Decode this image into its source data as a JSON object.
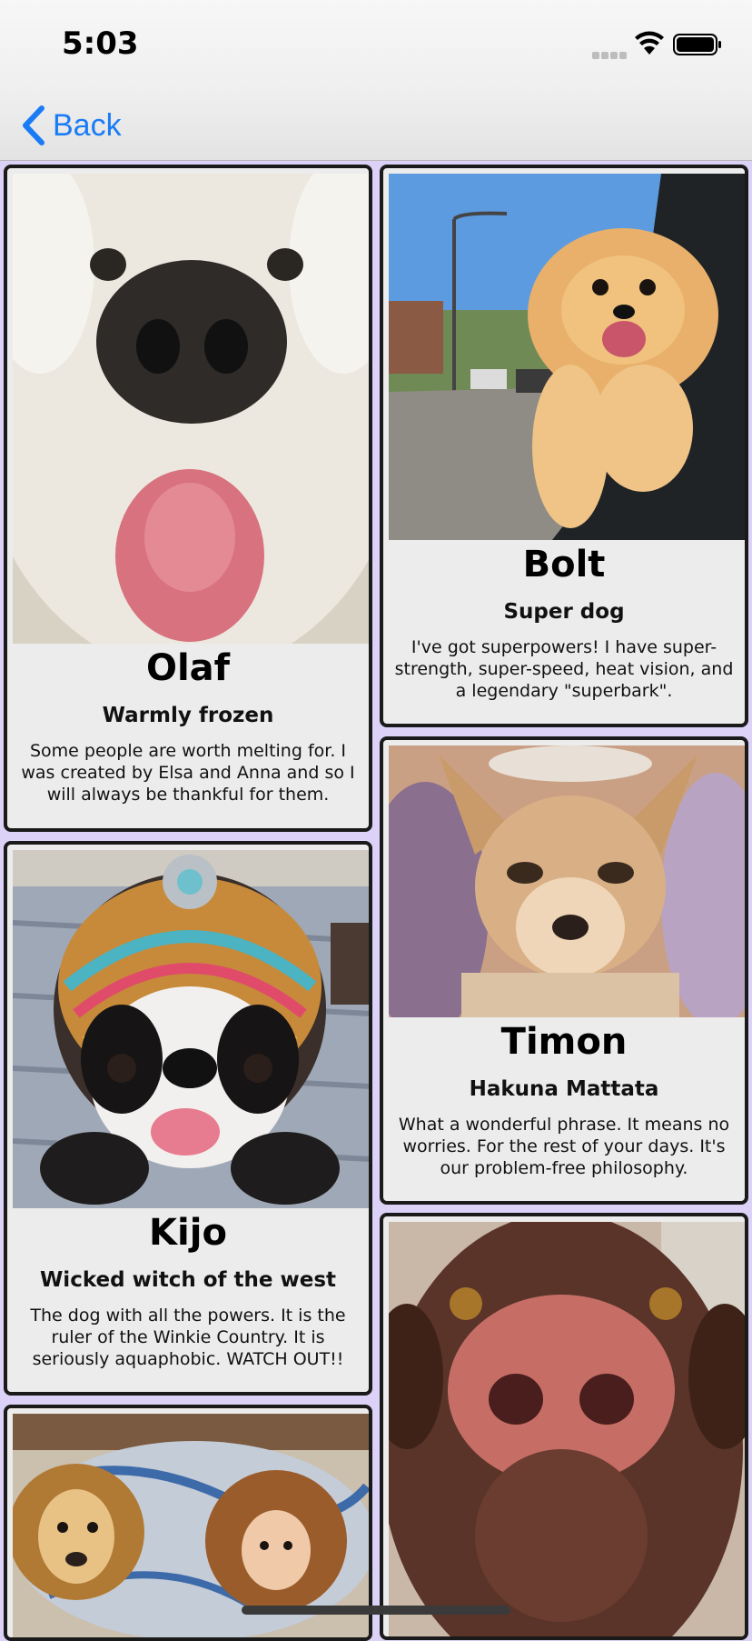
{
  "status": {
    "time": "5:03"
  },
  "nav": {
    "back_label": "Back"
  },
  "cards": [
    {
      "name": "Olaf",
      "tagline": "Warmly frozen",
      "description": "Some people are worth melting for. I was created by Elsa and Anna and so I will always be thankful for them."
    },
    {
      "name": "Bolt",
      "tagline": "Super dog",
      "description": "I've got superpowers! I have super-strength, super-speed, heat vision, and a legendary \"superbark\"."
    },
    {
      "name": "Timon",
      "tagline": "Hakuna Mattata",
      "description": "What a wonderful phrase. It means no worries. For the rest of your days. It's our problem-free philosophy."
    },
    {
      "name": "Kijo",
      "tagline": "Wicked witch of the west",
      "description": "The dog with all the powers. It is the ruler of the Winkie Country. It is seriously aquaphobic. WATCH OUT!!"
    }
  ],
  "colors": {
    "background": "#dcd2f7",
    "accent": "#1a7cf5",
    "card_border": "#1a1a1a",
    "card_bg": "#ececec"
  }
}
